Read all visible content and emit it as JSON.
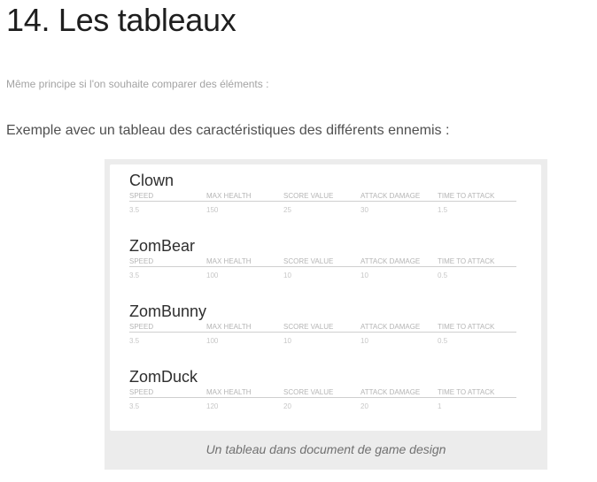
{
  "page": {
    "title": "14. Les tableaux",
    "intro": "Même principe si l'on souhaite comparer des éléments :",
    "example": "Exemple avec un tableau des caractéristiques des différents ennemis :"
  },
  "table": {
    "columns": [
      "SPEED",
      "MAX HEALTH",
      "SCORE VALUE",
      "ATTACK DAMAGE",
      "TIME TO ATTACK"
    ],
    "enemies": [
      {
        "name": "Clown",
        "values": [
          "3.5",
          "150",
          "25",
          "30",
          "1.5"
        ]
      },
      {
        "name": "ZomBear",
        "values": [
          "3.5",
          "100",
          "10",
          "10",
          "0.5"
        ]
      },
      {
        "name": "ZomBunny",
        "values": [
          "3.5",
          "100",
          "10",
          "10",
          "0.5"
        ]
      },
      {
        "name": "ZomDuck",
        "values": [
          "3.5",
          "120",
          "20",
          "20",
          "1"
        ]
      }
    ],
    "caption": "Un tableau dans document de game design"
  }
}
